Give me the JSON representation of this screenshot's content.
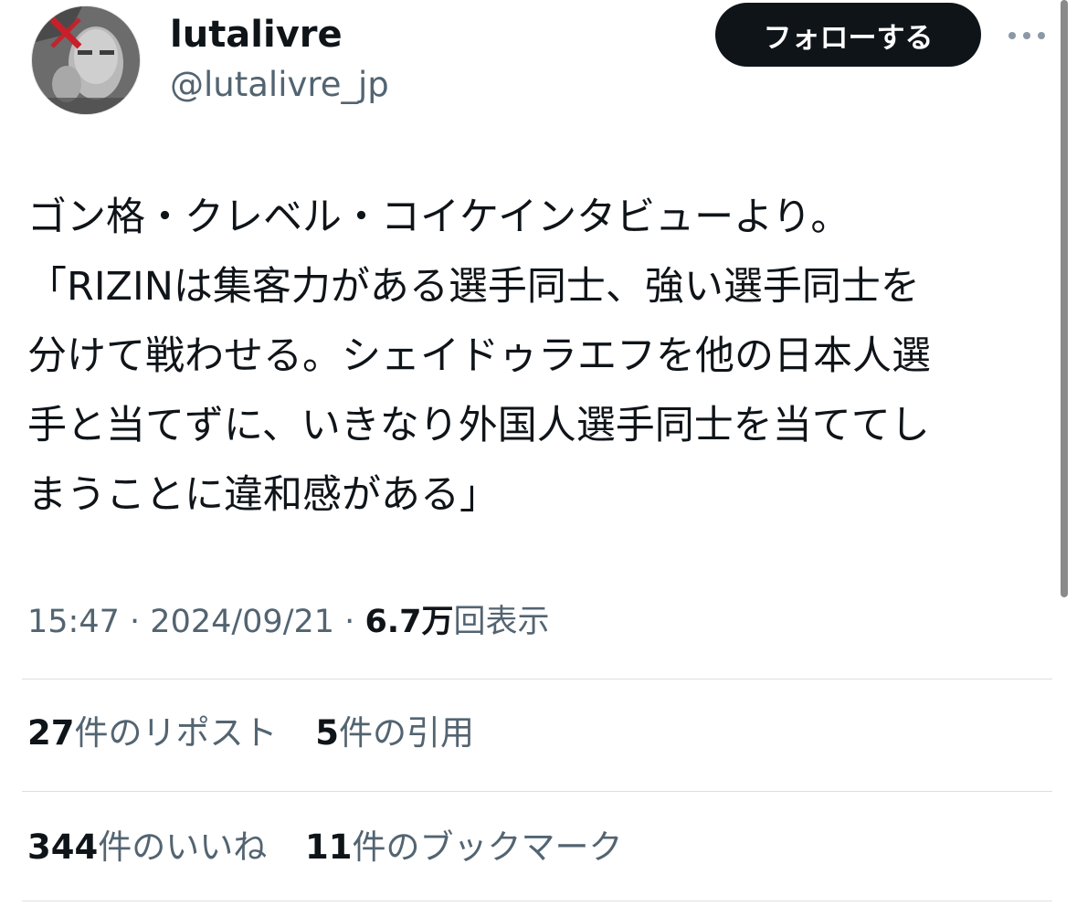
{
  "user": {
    "display_name": "lutalivre",
    "handle": "@lutalivre_jp"
  },
  "follow_button": {
    "label": "フォローする"
  },
  "more_menu": {
    "icon": "more-horizontal-icon"
  },
  "tweet": {
    "lines": [
      "ゴン格・クレベル・コイケインタビューより。",
      "「RIZINは集客力がある選手同士、強い選手同士を",
      "分けて戦わせる。シェイドゥラエフを他の日本人選",
      "手と当てずに、いきなり外国人選手同士を当ててし",
      "まうことに違和感がある」"
    ]
  },
  "meta": {
    "time": "15:47",
    "separator": "·",
    "date": "2024/09/21",
    "views_count": "6.7万",
    "views_label": "回表示"
  },
  "stats": {
    "reposts": {
      "count": "27",
      "label": "件のリポスト"
    },
    "quotes": {
      "count": "5",
      "label": "件の引用"
    },
    "likes": {
      "count": "344",
      "label": "件のいいね"
    },
    "bookmarks": {
      "count": "11",
      "label": "件のブックマーク"
    }
  },
  "colors": {
    "text_primary": "#0f1419",
    "text_secondary": "#536471",
    "button_bg": "#0f1419",
    "divider": "#dcdfe2"
  }
}
